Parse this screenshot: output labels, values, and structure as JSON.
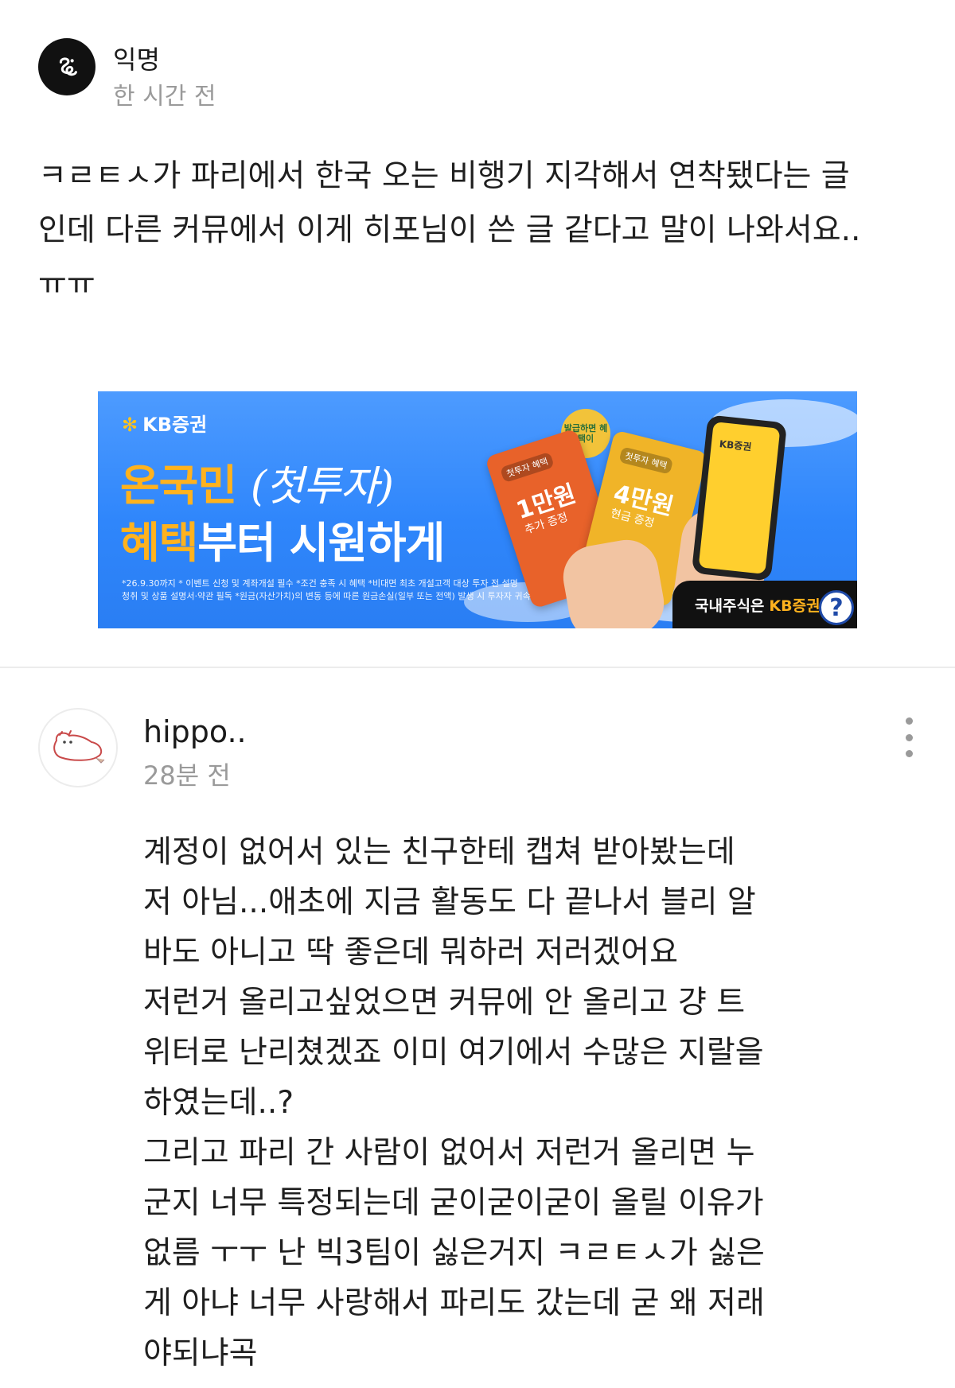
{
  "post": {
    "author": "익명",
    "time": "한 시간 전",
    "body": "ㅋㄹㅌㅅ가 파리에서 한국 오는 비행기 지각해서 연착됐다는 글\n인데 다른 커뮤에서 이게 히포님이 쓴 글 같다고 말이 나와서요..\nㅠㅠ",
    "avatar_icon": "anonymous-logo-icon"
  },
  "ad": {
    "brand": "KB증권",
    "headline_line1_a": "온국민",
    "headline_line1_b": "(첫투자)",
    "headline_line2_a": "혜택",
    "headline_line2_b": "부터 시원하게",
    "badge": "발급하면 혜택이",
    "card1_tag": "첫투자 혜택",
    "card1_amount": "1만원",
    "card1_sub": "추가 증정",
    "card2_tag": "첫투자 혜택",
    "card2_amount": "4만원",
    "card2_sub": "현금 증정",
    "phone_text": "KB증권",
    "disclaimer": "*26.9.30까지 * 이벤트 신청 및 계좌개설 필수 *조건 충족 시 혜택 *비대면 최초 개설고객 대상 투자 전 설명\n청취 및 상품 설명서·약관 필독 *원금(자산가치)의 변동 등에 따른 원금손실(일부 또는 전액) 발생 시 투자자 귀속",
    "cta_a": "국내주식은",
    "cta_b": "KB증권",
    "info_icon_label": "?",
    "colors": {
      "background": "#2f86fb",
      "accent": "#ffb21e"
    }
  },
  "comment": {
    "author": "hippo..",
    "time": "28분 전",
    "avatar_icon": "hippo-avatar-icon",
    "menu_icon": "more-vertical-icon",
    "body": "계정이 없어서 있는 친구한테 캡쳐 받아봤는데\n저 아님...애초에 지금 활동도 다 끝나서 블리 알\n바도 아니고 딱 좋은데 뭐하러 저러겠어요\n저런거 올리고싶었으면 커뮤에 안 올리고 걍 트\n위터로 난리쳤겠죠 이미 여기에서 수많은 지랄을\n하였는데..?\n그리고 파리 간 사람이 없어서 저런거 올리면 누\n군지 너무 특정되는데 굳이굳이굳이 올릴 이유가\n없름 ㅜㅜ 난 빅3팀이 싫은거지 ㅋㄹㅌㅅ가 싫은\n게 아냐 너무 사랑해서 파리도 갔는데 굳 왜 저래\n야되냐곡"
  }
}
